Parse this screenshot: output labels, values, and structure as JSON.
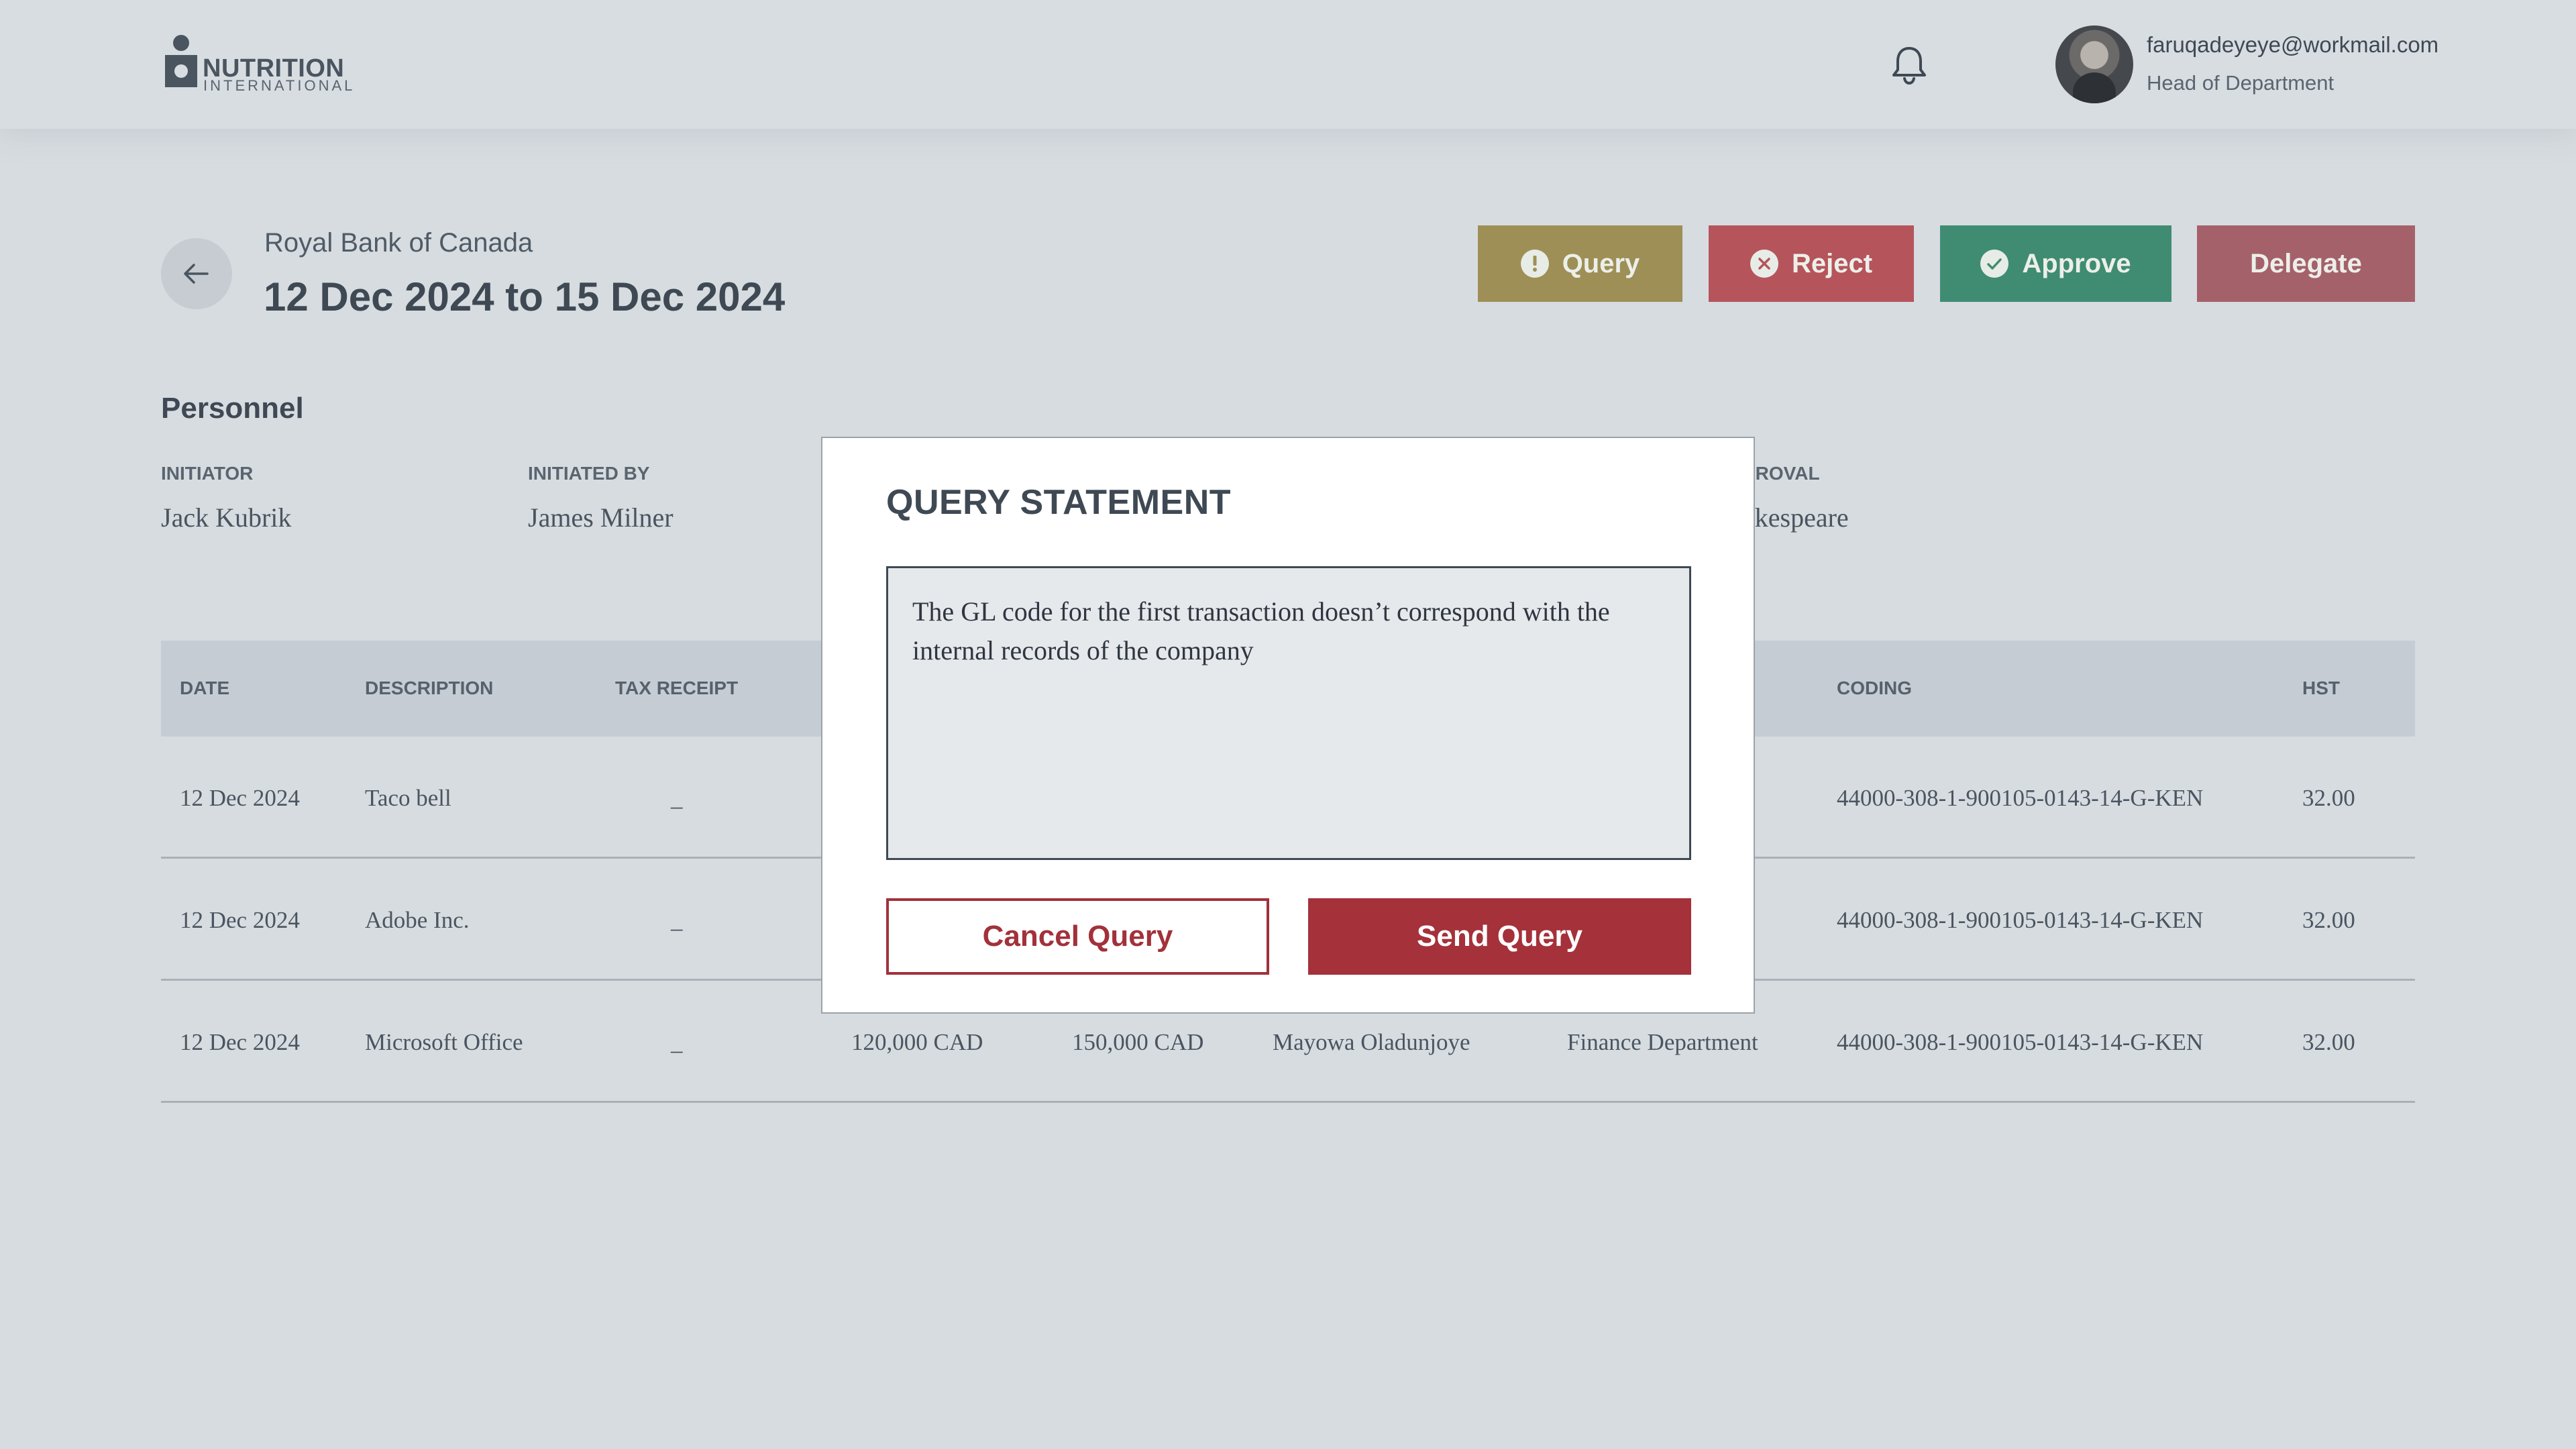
{
  "header": {
    "logo_name": "NUTRITION",
    "logo_sub": "INTERNATIONAL",
    "user_email": "faruqadeyeye@workmail.com",
    "user_role": "Head of Department"
  },
  "report": {
    "bank_name": "Royal Bank of Canada",
    "date_range": "12 Dec 2024 to 15 Dec 2024"
  },
  "actions": {
    "query_label": "Query",
    "reject_label": "Reject",
    "approve_label": "Approve",
    "delegate_label": "Delegate"
  },
  "personnel": {
    "title": "Personnel",
    "initiator_label": "INITIATOR",
    "initiator_value": "Jack Kubrik",
    "initiated_by_label": "INITIATED BY",
    "initiated_by_value": "James Milner",
    "approval_label_partial": "PROVAL",
    "approval_value_partial": "akespeare"
  },
  "table": {
    "headers": {
      "date": "DATE",
      "description": "DESCRIPTION",
      "tax_receipt": "TAX RECEIPT",
      "coding": "CODING",
      "hst": "HST"
    },
    "rows": [
      {
        "date": "12 Dec 2024",
        "description": "Taco bell",
        "tax_receipt": "_",
        "coding": "44000-308-1-900105-0143-14-G-KEN",
        "hst": "32.00"
      },
      {
        "date": "12 Dec 2024",
        "description": "Adobe Inc.",
        "tax_receipt": "_",
        "coding": "44000-308-1-900105-0143-14-G-KEN",
        "hst": "32.00"
      },
      {
        "date": "12 Dec 2024",
        "description": "Microsoft Office",
        "tax_receipt": "_",
        "amount_1": "120,000 CAD",
        "amount_2": "150,000 CAD",
        "person": "Mayowa Oladunjoye",
        "department": "Finance Department",
        "coding": "44000-308-1-900105-0143-14-G-KEN",
        "hst": "32.00"
      }
    ]
  },
  "modal": {
    "title": "QUERY STATEMENT",
    "statement": "The GL code for the first transaction doesn’t correspond with the internal records of the company",
    "cancel_label": "Cancel Query",
    "send_label": "Send Query"
  },
  "colors": {
    "query": "#9e8f56",
    "reject": "#b6545b",
    "approve": "#3f8c73",
    "delegate": "#a5616a",
    "send": "#a5313a"
  }
}
